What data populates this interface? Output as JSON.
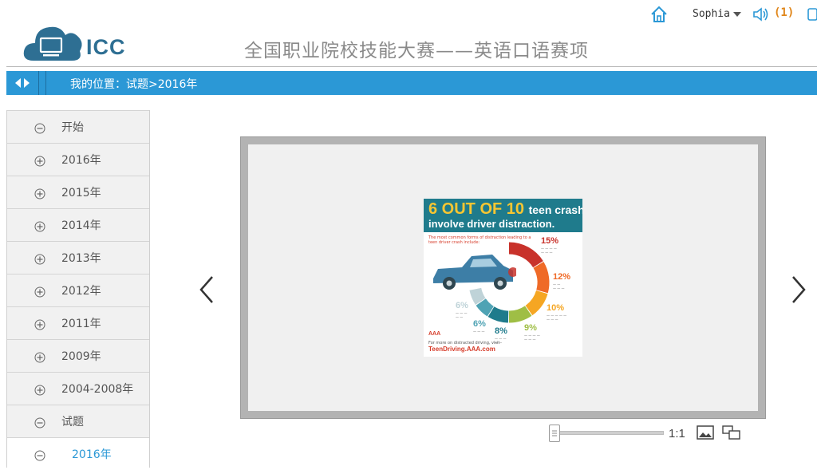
{
  "header": {
    "user_name": "Sophia",
    "notification_count": "(1)",
    "logo_text": "ICC",
    "title": "全国职业院校技能大赛——英语口语赛项"
  },
  "breadcrumb": {
    "label": "我的位置：试题>2016年"
  },
  "sidebar": {
    "items": [
      {
        "label": "开始",
        "icon": "collapse-circle-icon"
      },
      {
        "label": "2016年",
        "icon": "expand-circle-icon"
      },
      {
        "label": "2015年",
        "icon": "expand-circle-icon"
      },
      {
        "label": "2014年",
        "icon": "expand-circle-icon"
      },
      {
        "label": "2013年",
        "icon": "expand-circle-icon"
      },
      {
        "label": "2012年",
        "icon": "expand-circle-icon"
      },
      {
        "label": "2011年",
        "icon": "expand-circle-icon"
      },
      {
        "label": "2009年",
        "icon": "expand-circle-icon"
      },
      {
        "label": "2004-2008年",
        "icon": "expand-circle-icon"
      },
      {
        "label": "试题",
        "icon": "collapse-circle-icon"
      },
      {
        "label": "2016年",
        "icon": "collapse-circle-icon",
        "active": true
      }
    ]
  },
  "infographic": {
    "headline_big": "6 OUT OF 10",
    "headline_small": "teen crashes",
    "headline_line2": "involve driver distraction.",
    "subtitle": "The most common forms of distraction leading to a teen driver crash include:",
    "segments": [
      {
        "pct": "15%",
        "color": "#c8322b"
      },
      {
        "pct": "12%",
        "color": "#ef6a27"
      },
      {
        "pct": "10%",
        "color": "#f5a623"
      },
      {
        "pct": "9%",
        "color": "#9fbe45"
      },
      {
        "pct": "8%",
        "color": "#1f7b8c"
      },
      {
        "pct": "6%",
        "color": "#4fa3b4"
      },
      {
        "pct": "6%",
        "color": "#bfd3d8"
      }
    ],
    "footer_small": "For more on distracted driving, visit",
    "footer_url": "TeenDriving.AAA.com"
  },
  "viewer": {
    "zoom_label": "1:1"
  },
  "colors": {
    "accent": "#2b98d6",
    "logo": "#2e6f93",
    "notif": "#e0861a"
  }
}
